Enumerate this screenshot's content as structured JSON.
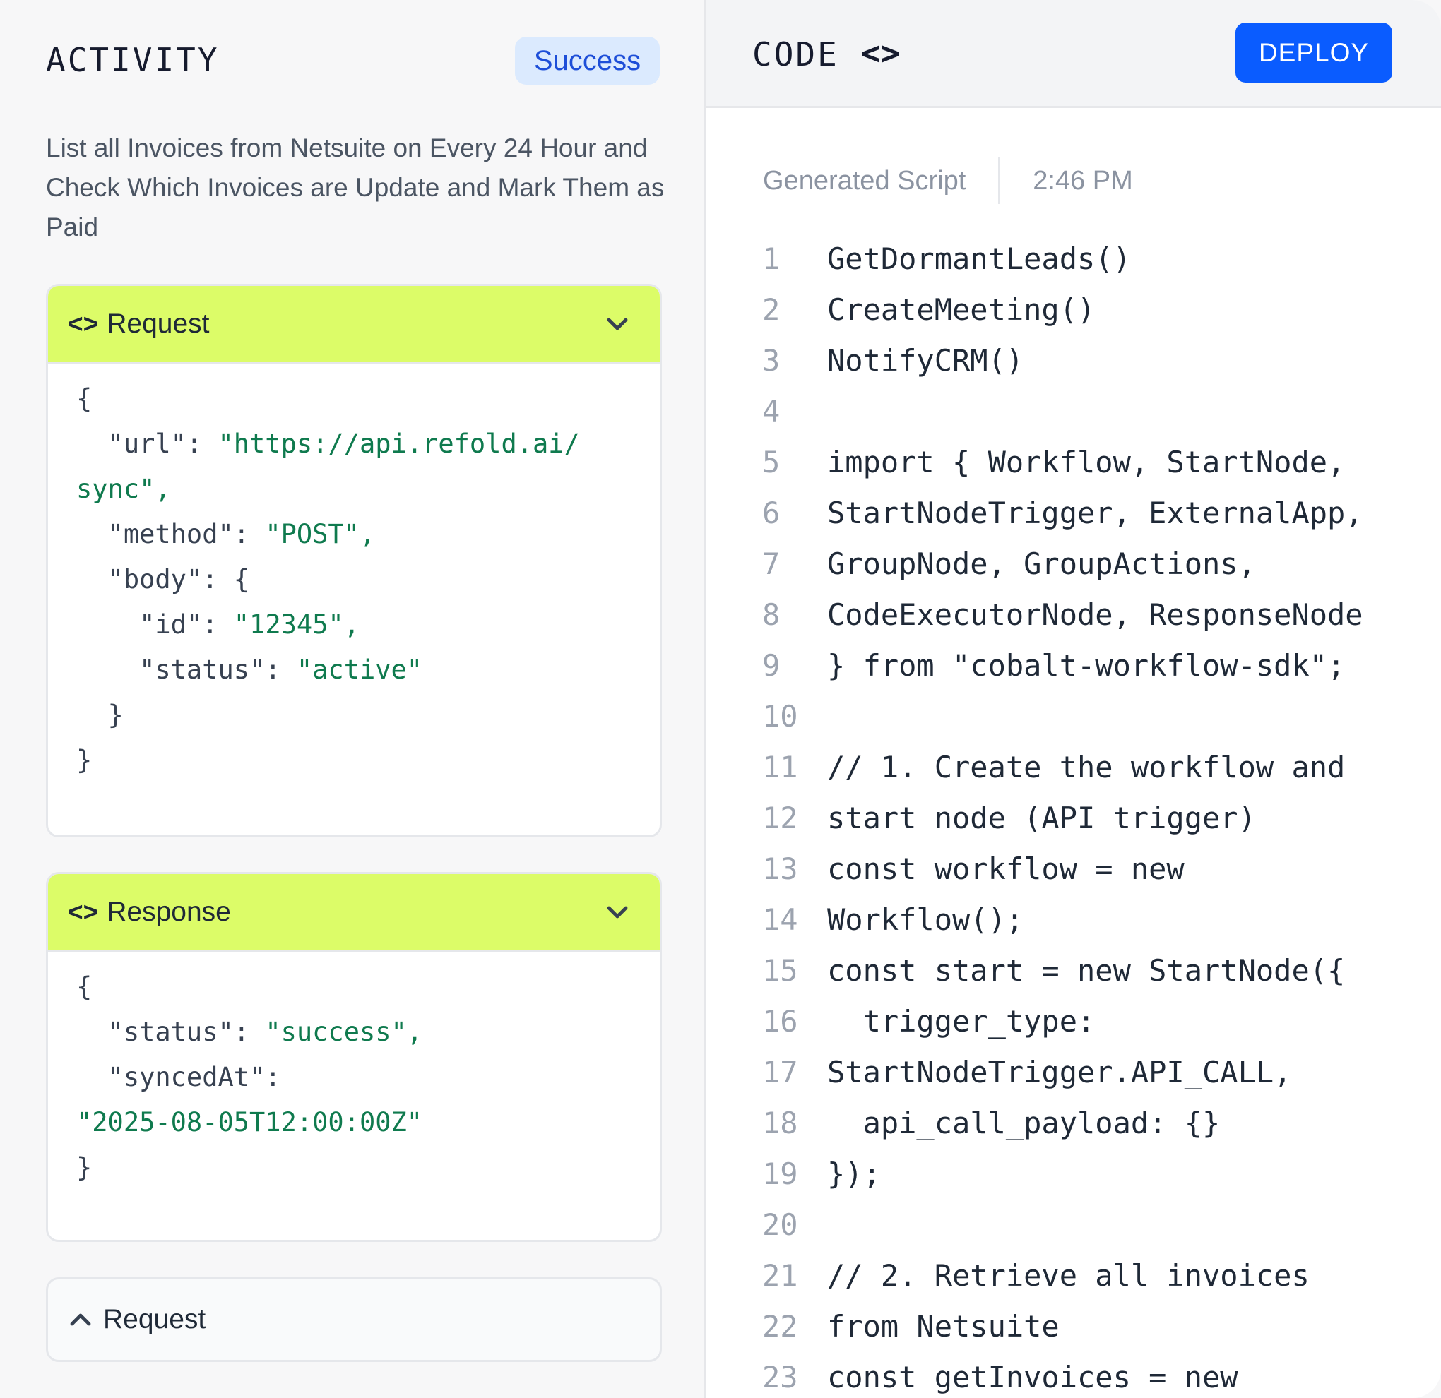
{
  "activity": {
    "title": "ACTIVITY",
    "status": "Success",
    "description": "List all Invoices from Netsuite on Every 24 Hour and Check Which Invoices are Update and Mark Them as Paid"
  },
  "request_card": {
    "icon": "<>",
    "label": "Request",
    "lines": [
      {
        "plain": "{",
        "str": ""
      },
      {
        "plain": "  \"url\": ",
        "str": "\"https://api.refold.ai/"
      },
      {
        "plain": "",
        "str": "sync\","
      },
      {
        "plain": "  \"method\": ",
        "str": "\"POST\","
      },
      {
        "plain": "  \"body\": {",
        "str": ""
      },
      {
        "plain": "    \"id\": ",
        "str": "\"12345\","
      },
      {
        "plain": "    \"status\": ",
        "str": "\"active\""
      },
      {
        "plain": "  }",
        "str": ""
      },
      {
        "plain": "}",
        "str": ""
      }
    ]
  },
  "response_card": {
    "icon": "<>",
    "label": "Response",
    "lines": [
      {
        "plain": "{",
        "str": ""
      },
      {
        "plain": "  \"status\": ",
        "str": "\"success\","
      },
      {
        "plain": "  \"syncedAt\":",
        "str": ""
      },
      {
        "plain": "",
        "str": "\"2025-08-05T12:00:00Z\""
      },
      {
        "plain": "}",
        "str": ""
      }
    ]
  },
  "collapsed_card": {
    "label": "Request"
  },
  "code_panel": {
    "title": "CODE",
    "title_icon": "<>",
    "deploy_label": "DEPLOY",
    "script_label": "Generated Script",
    "time": "2:46 PM",
    "lines": [
      {
        "n": "1",
        "text": "GetDormantLeads()"
      },
      {
        "n": "2",
        "text": "CreateMeeting()"
      },
      {
        "n": "3",
        "text": "NotifyCRM()"
      },
      {
        "n": "4",
        "text": ""
      },
      {
        "n": "5",
        "text": "import { Workflow, StartNode,"
      },
      {
        "n": "6",
        "text": "StartNodeTrigger, ExternalApp,"
      },
      {
        "n": "7",
        "text": "GroupNode, GroupActions,"
      },
      {
        "n": "8",
        "text": "CodeExecutorNode, ResponseNode"
      },
      {
        "n": "9",
        "text": "} from \"cobalt-workflow-sdk\";"
      },
      {
        "n": "10",
        "text": ""
      },
      {
        "n": "11",
        "text": "// 1. Create the workflow and"
      },
      {
        "n": "12",
        "text": "start node (API trigger)"
      },
      {
        "n": "13",
        "text": "const workflow = new"
      },
      {
        "n": "14",
        "text": "Workflow();"
      },
      {
        "n": "15",
        "text": "const start = new StartNode({"
      },
      {
        "n": "16",
        "text": "  trigger_type:"
      },
      {
        "n": "17",
        "text": "StartNodeTrigger.API_CALL,"
      },
      {
        "n": "18",
        "text": "  api_call_payload: {}"
      },
      {
        "n": "19",
        "text": "});"
      },
      {
        "n": "20",
        "text": ""
      },
      {
        "n": "21",
        "text": "// 2. Retrieve all invoices"
      },
      {
        "n": "22",
        "text": "from Netsuite"
      },
      {
        "n": "23",
        "text": "const getInvoices = new"
      }
    ]
  }
}
